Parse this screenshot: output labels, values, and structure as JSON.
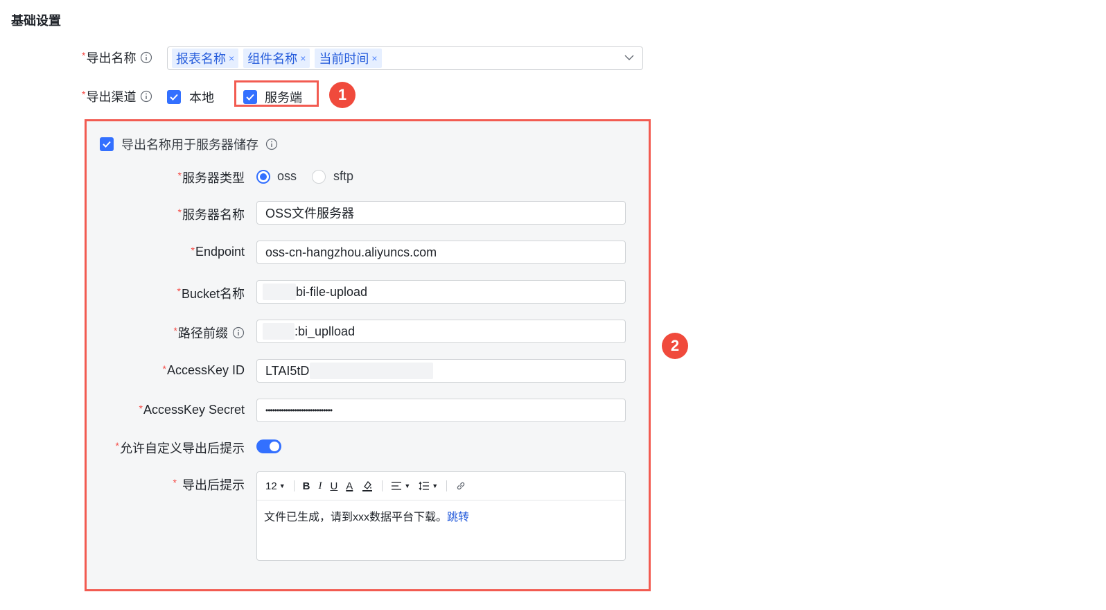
{
  "section_title": "基础设置",
  "export_name": {
    "label": "导出名称",
    "tags": [
      {
        "label": "报表名称"
      },
      {
        "label": "组件名称"
      },
      {
        "label": "当前时间"
      }
    ],
    "tag_remove_glyph": "×"
  },
  "export_channel": {
    "label": "导出渠道",
    "local_label": "本地",
    "local_checked": true,
    "server_label": "服务端",
    "server_checked": true
  },
  "callouts": {
    "one": "1",
    "two": "2"
  },
  "server_panel": {
    "use_name_label": "导出名称用于服务器储存",
    "use_name_checked": true,
    "server_type": {
      "label": "服务器类型",
      "options": [
        {
          "label": "oss",
          "selected": true
        },
        {
          "label": "sftp",
          "selected": false
        }
      ]
    },
    "server_name": {
      "label": "服务器名称",
      "value": "OSS文件服务器"
    },
    "endpoint": {
      "label": "Endpoint",
      "value": "oss-cn-hangzhou.aliyuncs.com"
    },
    "bucket": {
      "label": "Bucket名称",
      "value": "bi-file-upload"
    },
    "path_prefix": {
      "label": "路径前缀",
      "value": ":bi_uplload"
    },
    "access_key_id": {
      "label": "AccessKey ID",
      "value": "LTAI5tD"
    },
    "access_key_secret": {
      "label": "AccessKey Secret",
      "value": "••••••••••••••••••••••••••••••"
    },
    "allow_custom_tip": {
      "label": "允许自定义导出后提示",
      "enabled": true
    },
    "export_tip": {
      "label": "导出后提示",
      "font_size": "12",
      "toolbar_glyphs": {
        "bold": "B",
        "italic": "I",
        "underline": "U",
        "font_color": "A"
      },
      "content_text": "文件已生成，请到xxx数据平台下载。",
      "content_link": "跳转"
    }
  },
  "colors": {
    "accent": "#3370ff",
    "required": "#f54a45",
    "highlight_border": "#f25b51",
    "badge": "#f04a3c",
    "panel_bg": "#f5f6f7"
  }
}
